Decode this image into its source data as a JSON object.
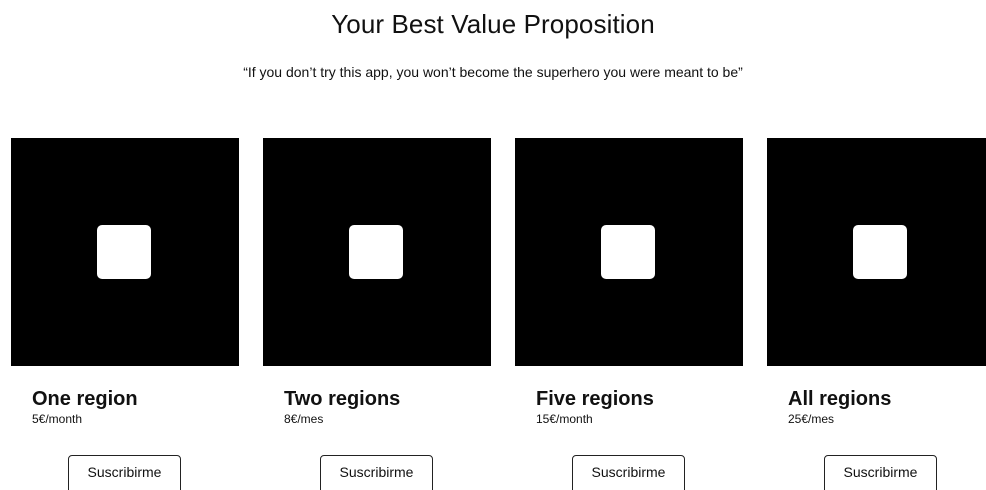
{
  "header": {
    "title": "Your Best Value Proposition",
    "tagline": "“If you don’t try this app, you won’t become the superhero you were meant to be”"
  },
  "plans": [
    {
      "name": "One region",
      "price": "5€/month",
      "button_label": "Suscribirme",
      "image_icon": "image-placeholder-icon"
    },
    {
      "name": "Two regions",
      "price": "8€/mes",
      "button_label": "Suscribirme",
      "image_icon": "image-placeholder-icon"
    },
    {
      "name": "Five regions",
      "price": "15€/month",
      "button_label": "Suscribirme",
      "image_icon": "image-placeholder-icon"
    },
    {
      "name": "All regions",
      "price": "25€/mes",
      "button_label": "Suscribirme",
      "image_icon": "image-placeholder-icon"
    }
  ],
  "colors": {
    "image_background": "#000000",
    "placeholder": "#ffffff",
    "text": "#111111"
  }
}
